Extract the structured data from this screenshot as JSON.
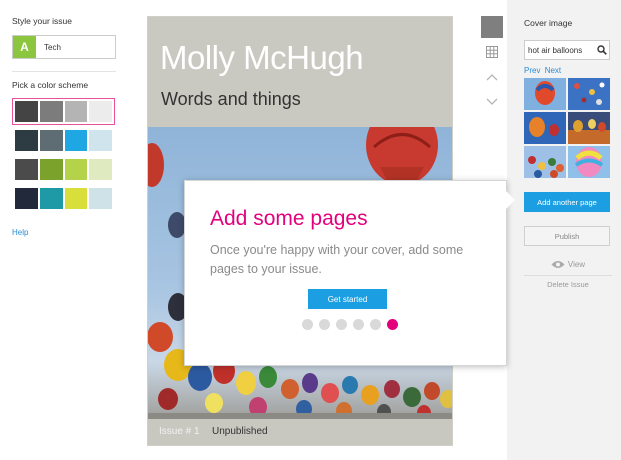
{
  "left": {
    "style_label": "Style your issue",
    "style_badge": "A",
    "style_name": "Tech",
    "scheme_label": "Pick a color scheme",
    "schemes": [
      {
        "colors": [
          "#444444",
          "#7c7c7c",
          "#b4b4b4",
          "#ececec"
        ],
        "selected": true
      },
      {
        "colors": [
          "#2d3b43",
          "#5e6d74",
          "#1fa7e3",
          "#cfe4ec"
        ],
        "selected": false
      },
      {
        "colors": [
          "#4b4b4b",
          "#7ba32c",
          "#b4d24a",
          "#dfeac1"
        ],
        "selected": false
      },
      {
        "colors": [
          "#22293a",
          "#1e9aa6",
          "#d9df3a",
          "#cfe2e8"
        ],
        "selected": false
      }
    ],
    "help": "Help"
  },
  "cover": {
    "title": "Molly McHugh",
    "subtitle": "Words and things",
    "issue": "Issue # 1",
    "status": "Unpublished"
  },
  "popover": {
    "title": "Add some pages",
    "text": "Once you're happy with your cover, add some pages to your issue.",
    "button": "Get started",
    "dots": 6,
    "active_dot": 6
  },
  "right": {
    "cover_image_label": "Cover image",
    "search_value": "hot air balloons",
    "prev": "Prev",
    "next": "Next",
    "add_page": "Add another page",
    "publish": "Publish",
    "view": "View",
    "delete": "Delete Issue"
  },
  "colors": {
    "accent_blue": "#1b9fe2",
    "accent_pink": "#e3007d",
    "link_blue": "#2a8bd6"
  },
  "icons": [
    "grid-icon",
    "chevron-up-icon",
    "chevron-down-icon",
    "search-icon",
    "eye-icon"
  ]
}
